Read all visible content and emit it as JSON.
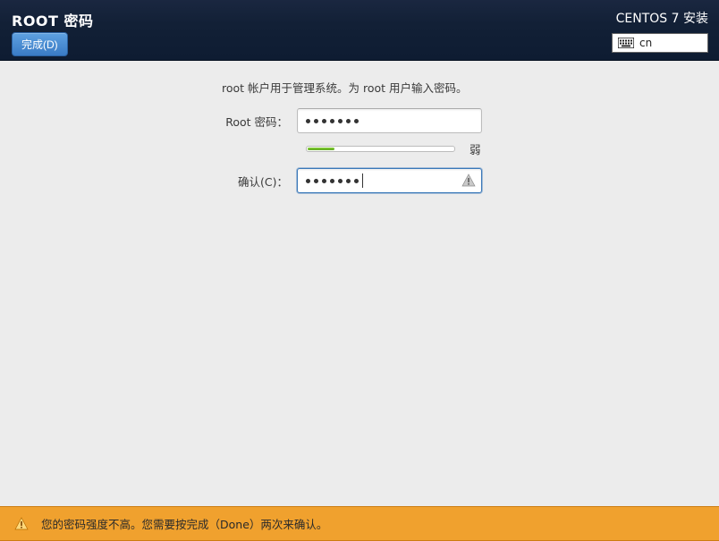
{
  "header": {
    "title": "ROOT 密码",
    "done_label": "完成(D)",
    "installer_title": "CENTOS 7 安装",
    "lang_code": "cn"
  },
  "form": {
    "description": "root 帐户用于管理系统。为 root 用户输入密码。",
    "password_label": "Root 密码：",
    "confirm_label": "确认(C)：",
    "password_value": "•••••••",
    "confirm_value": "•••••••",
    "strength_label": "弱",
    "strength_percent": 18
  },
  "warning": {
    "message": "您的密码强度不高。您需要按完成（Done）两次来确认。"
  }
}
